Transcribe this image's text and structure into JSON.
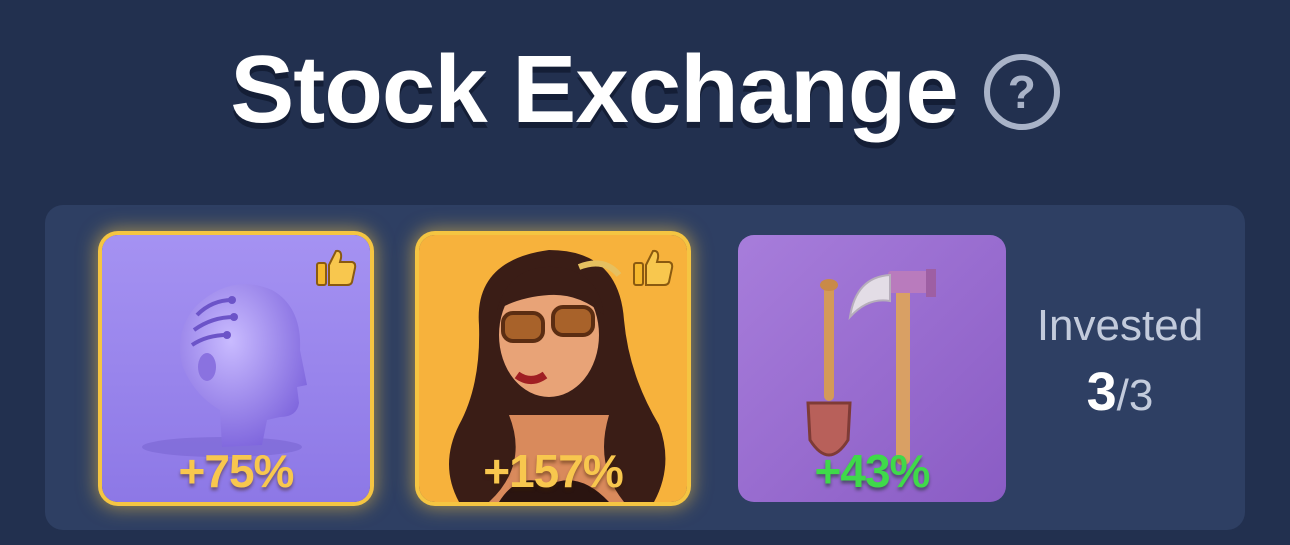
{
  "header": {
    "title": "Stock Exchange",
    "help_symbol": "?"
  },
  "stocks": [
    {
      "name": "ai-head",
      "icon": "robot-head-icon",
      "change": "+75%",
      "liked": true,
      "highlight": "#f5c542",
      "change_color": "#f8c74e",
      "bg": "#9b87ee"
    },
    {
      "name": "pinup-girl",
      "icon": "woman-portrait-icon",
      "change": "+157%",
      "liked": true,
      "highlight": "#f5c542",
      "change_color": "#f8c74e",
      "bg": "#f7b23c"
    },
    {
      "name": "tools",
      "icon": "shovel-axe-icon",
      "change": "+43%",
      "liked": false,
      "highlight": null,
      "change_color": "#3fd94a",
      "bg": "#9b6fd0"
    }
  ],
  "invested": {
    "label": "Invested",
    "current": "3",
    "total": "/3"
  },
  "colors": {
    "background": "#22304f",
    "panel": "#2e3f63",
    "accent_gold": "#f5c542",
    "positive_green": "#3fd94a"
  }
}
